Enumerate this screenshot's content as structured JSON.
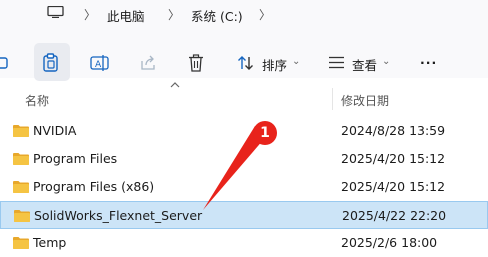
{
  "address": {
    "breadcrumb": [
      "此电脑",
      "系统 (C:)"
    ]
  },
  "toolbar": {
    "sort_label": "排序",
    "view_label": "查看",
    "more_label": "···"
  },
  "columns": {
    "name": "名称",
    "modified": "修改日期"
  },
  "files": [
    {
      "name": "NVIDIA",
      "modified": "2024/8/28 13:59",
      "selected": false
    },
    {
      "name": "Program Files",
      "modified": "2025/4/20 15:12",
      "selected": false
    },
    {
      "name": "Program Files (x86)",
      "modified": "2025/4/20 15:12",
      "selected": false
    },
    {
      "name": "SolidWorks_Flexnet_Server",
      "modified": "2025/4/22 22:20",
      "selected": true
    },
    {
      "name": "Temp",
      "modified": "2025/2/6 18:00",
      "selected": false
    }
  ],
  "annotation": {
    "badge": "1",
    "color": "#e8231b"
  },
  "colors": {
    "accent": "#0067c0",
    "selection": "#cce4f7",
    "folder": "#f5c443"
  }
}
